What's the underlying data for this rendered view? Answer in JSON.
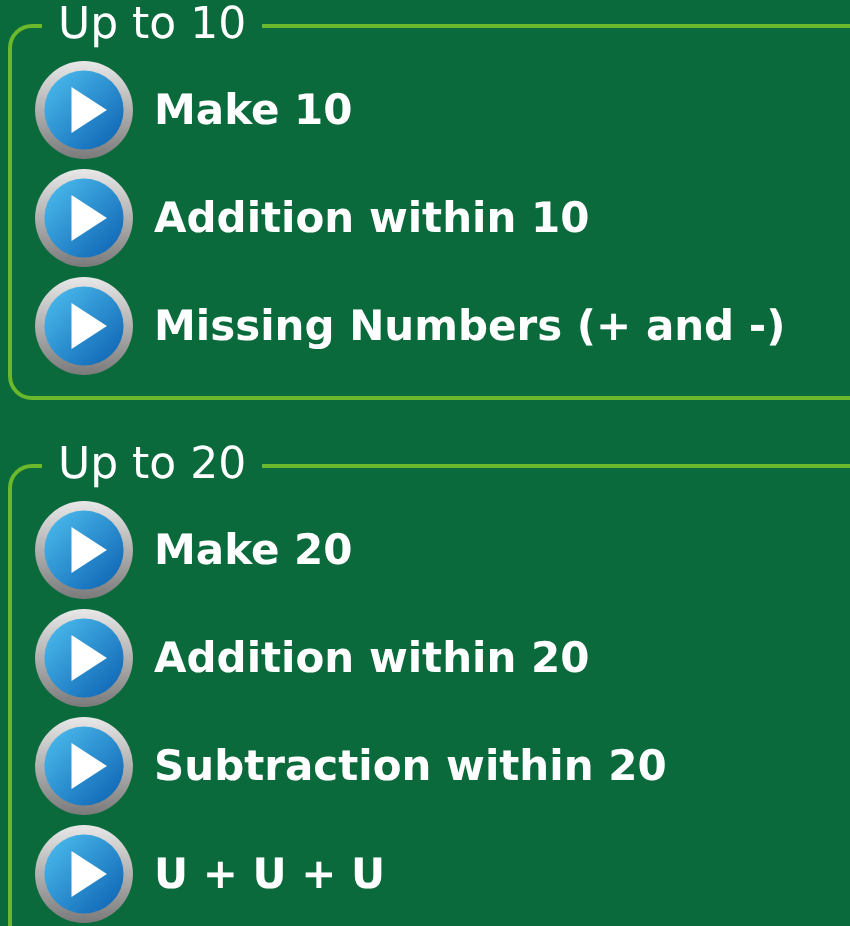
{
  "sections": [
    {
      "title": "Up to 10",
      "items": [
        {
          "label": "Make 10"
        },
        {
          "label": "Addition within 10"
        },
        {
          "label": "Missing Numbers (+ and -)"
        }
      ]
    },
    {
      "title": "Up to 20",
      "items": [
        {
          "label": "Make 20"
        },
        {
          "label": "Addition within 20"
        },
        {
          "label": "Subtraction within 20"
        },
        {
          "label": "U + U + U"
        }
      ]
    }
  ]
}
